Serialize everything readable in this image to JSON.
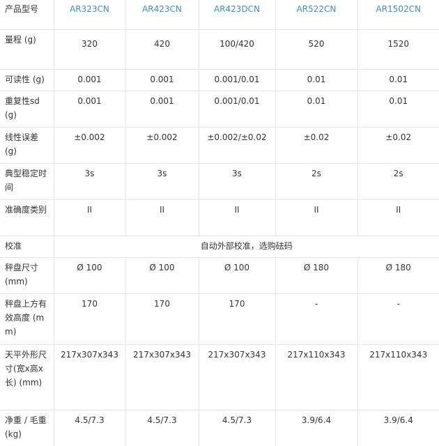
{
  "table": {
    "corner_label": "产品型号",
    "models": [
      "AR323CN",
      "AR423CN",
      "AR423DCN",
      "AR522CN",
      "AR1502CN"
    ],
    "rows": {
      "capacity": {
        "label": "量程 (g)",
        "values": [
          "320",
          "420",
          "100/420",
          "520",
          "1520"
        ]
      },
      "readability": {
        "label": "可读性 (g)",
        "values": [
          "0.001",
          "0.001",
          "0.001/0.01",
          "0.01",
          "0.01"
        ]
      },
      "repeatability": {
        "label": "重复性sd (g)",
        "values": [
          "0.001",
          "0.001",
          "0.001/0.01",
          "0.01",
          "0.01"
        ]
      },
      "linearity": {
        "label": "线性误差 (g)",
        "values": [
          "±0.002",
          "±0.002",
          "±0.002/±0.02",
          "±0.02",
          "±0.02"
        ]
      },
      "stabilization": {
        "label": "典型稳定时间",
        "values": [
          "3s",
          "3s",
          "3s",
          "2s",
          "2s"
        ]
      },
      "accuracy_class": {
        "label": "准确度类别",
        "values": [
          "II",
          "II",
          "II",
          "II",
          "II"
        ]
      },
      "calibration": {
        "label": "校准",
        "value": "自动外部校准，选购砝码"
      },
      "pan_size": {
        "label": "秤盘尺寸 (mm)",
        "values": [
          "Ø 100",
          "Ø 100",
          "Ø 100",
          "Ø 180",
          "Ø 180"
        ]
      },
      "pan_height": {
        "label": "秤盘上方有效高度 (mm)",
        "values": [
          "170",
          "170",
          "170",
          "-",
          "-"
        ]
      },
      "dimensions": {
        "label": "天平外形尺寸(宽x高x长) (mm)",
        "values": [
          "217x307x343",
          "217x307x343",
          "217x307x343",
          "217x110x343",
          "217x110x343"
        ]
      },
      "weight": {
        "label": "净重 / 毛重 (kg)",
        "values": [
          "4.5/7.3",
          "4.5/7.3",
          "4.5/7.3",
          "3.9/6.4",
          "3.9/6.4"
        ]
      }
    }
  },
  "colors": {
    "model_text": "#3a8fc8",
    "body_text": "#333333",
    "grid_line": "#e6e6e6"
  }
}
